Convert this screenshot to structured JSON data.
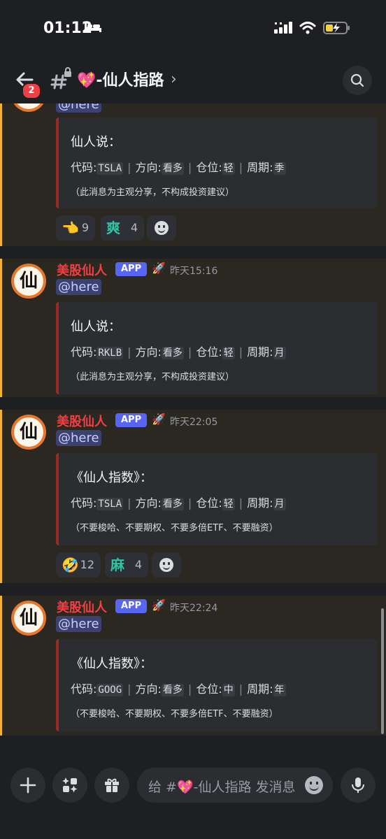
{
  "status": {
    "time": "01:12"
  },
  "header": {
    "badge": "2",
    "channel_emoji": "💖",
    "channel_title": "-仙人指路",
    "chevron": "›"
  },
  "messages": [
    {
      "mention": "@here",
      "embed": {
        "title": "仙人说：",
        "fields": {
          "code_label": "代码:",
          "code": "TSLA",
          "dir_label": "方向:",
          "dir": "看多",
          "pos_label": "仓位:",
          "pos": "轻",
          "period_label": "周期:",
          "period": "季"
        },
        "note": "（此消息为主观分享，不构成投资建议）"
      },
      "reactions": [
        {
          "emoji": "👈",
          "count": "9"
        },
        {
          "emoji": "爽",
          "count": "4"
        }
      ]
    },
    {
      "author": "美股仙人",
      "tag": "APP",
      "timestamp": "昨天15:16",
      "avatar_char": "仙",
      "mention": "@here",
      "embed": {
        "title": "仙人说：",
        "fields": {
          "code_label": "代码:",
          "code": "RKLB",
          "dir_label": "方向:",
          "dir": "看多",
          "pos_label": "仓位:",
          "pos": "轻",
          "period_label": "周期:",
          "period": "月"
        },
        "note": "（此消息为主观分享，不构成投资建议）"
      }
    },
    {
      "author": "美股仙人",
      "tag": "APP",
      "timestamp": "昨天22:05",
      "avatar_char": "仙",
      "mention": "@here",
      "embed": {
        "title": "《仙人指数》：",
        "fields": {
          "code_label": "代码:",
          "code": "TSLA",
          "dir_label": "方向:",
          "dir": "看多",
          "pos_label": "仓位:",
          "pos": "轻",
          "period_label": "周期:",
          "period": "月"
        },
        "note": "（不要梭哈、不要期权、不要多倍ETF、不要融资）"
      },
      "reactions": [
        {
          "emoji": "🤣",
          "count": "12"
        },
        {
          "emoji": "麻",
          "count": "4"
        }
      ]
    },
    {
      "author": "美股仙人",
      "tag": "APP",
      "timestamp": "昨天22:24",
      "avatar_char": "仙",
      "mention": "@here",
      "embed": {
        "title": "《仙人指数》：",
        "fields": {
          "code_label": "代码:",
          "code": "GOOG",
          "dir_label": "方向:",
          "dir": "看多",
          "pos_label": "仓位:",
          "pos": "中",
          "period_label": "周期:",
          "period": "年"
        },
        "note": "（不要梭哈、不要期权、不要多倍ETF、不要融资）"
      }
    }
  ],
  "composer": {
    "placeholder": "给 #💖-仙人指路 发消息"
  },
  "icons": {
    "back": "arrow-left-icon",
    "channel": "text-channel-lock-icon",
    "search": "search-icon",
    "plus": "plus-icon",
    "apps": "apps-icon",
    "gift": "gift-icon",
    "emoji": "emoji-icon",
    "mic": "microphone-icon",
    "rocket": "rocket-icon",
    "add_reaction": "add-reaction-icon"
  },
  "colors": {
    "author": "#f23f43",
    "app_tag": "#5865f2",
    "mention_bg": "#3c4270",
    "embed_border": "#992d22",
    "highlight_stripe": "#f0b232",
    "badge": "#f23f43"
  }
}
